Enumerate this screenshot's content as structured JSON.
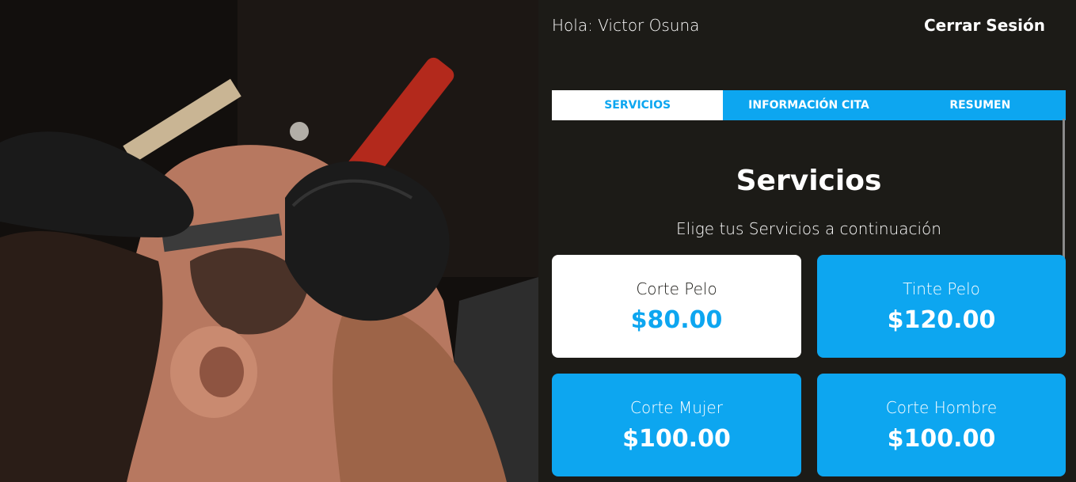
{
  "header": {
    "greeting": "Hola: Victor Osuna",
    "logout_label": "Cerrar Sesión"
  },
  "tabs": [
    {
      "label": "Servicios",
      "active": true
    },
    {
      "label": "Información Cita",
      "active": false
    },
    {
      "label": "Resumen",
      "active": false
    }
  ],
  "section": {
    "title": "Servicios",
    "subtitle": "Elige tus Servicios a continuación"
  },
  "services": [
    {
      "name": "Corte Pelo",
      "price": "$80.00",
      "selected": true
    },
    {
      "name": "Tinte Pelo",
      "price": "$120.00",
      "selected": false
    },
    {
      "name": "Corte Mujer",
      "price": "$100.00",
      "selected": false
    },
    {
      "name": "Corte Hombre",
      "price": "$100.00",
      "selected": false
    }
  ],
  "colors": {
    "background": "#1c1b17",
    "accent": "#0da6f0",
    "text": "#ffffff"
  },
  "hero": {
    "icon": "barber-shave-photo"
  }
}
